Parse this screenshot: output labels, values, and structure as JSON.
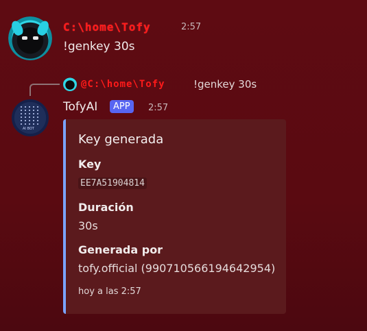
{
  "message1": {
    "author": "C:\\home\\Tofy",
    "timestamp": "2:57",
    "content": "!genkey 30s"
  },
  "reply": {
    "author": "@C:\\home\\Tofy",
    "text": "!genkey 30s"
  },
  "bot_message": {
    "author": "TofyAI",
    "badge": "APP",
    "timestamp": "2:57",
    "avatar_caption": "AI BOT",
    "embed": {
      "title": "Key generada",
      "fields": [
        {
          "name": "Key",
          "value": "EE7A51904814"
        },
        {
          "name": "Duración",
          "value": "30s"
        },
        {
          "name": "Generada por",
          "value": "tofy.official (990710566194642954)"
        }
      ],
      "footer": "hoy a las 2:57",
      "accent_color": "#7aa3ff"
    }
  },
  "colors": {
    "background": "#5a0a11",
    "author_red": "#ff1a1a",
    "app_badge": "#5865f2"
  }
}
